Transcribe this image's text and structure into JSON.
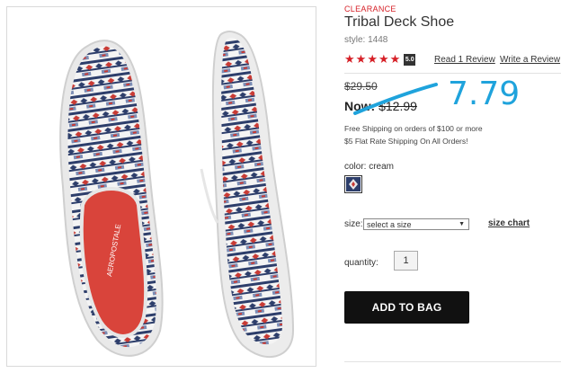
{
  "product": {
    "badge": "CLEARANCE",
    "name": "Tribal Deck Shoe",
    "style": "style: 1448",
    "rating_value": "5.0",
    "read_reviews": "Read 1 Review",
    "write_review": "Write a Review",
    "price_old": "$29.50",
    "price_now_label": "Now: ",
    "price_now_value": "$12.99",
    "handwritten_price": "7.79",
    "shipping_line1": "Free Shipping on orders of $100 or more",
    "shipping_line2": "$5 Flat Rate Shipping On All Orders!",
    "color_label": "color: cream",
    "size_label": "size:",
    "size_placeholder": "select a size",
    "size_chart": "size chart",
    "quantity_label": "quantity:",
    "quantity_value": "1",
    "add_to_bag": "ADD TO BAG",
    "brand_on_insole": "AEROPOSTALE",
    "stars_filled": 5,
    "stars_total": 5
  },
  "colors": {
    "red": "#d61f26",
    "annotation_blue": "#1fa3dc",
    "navy": "#2d3e6b",
    "button_black": "#111111"
  },
  "icons": [
    "star-icon",
    "dropdown-arrow-icon",
    "swatch-icon"
  ]
}
